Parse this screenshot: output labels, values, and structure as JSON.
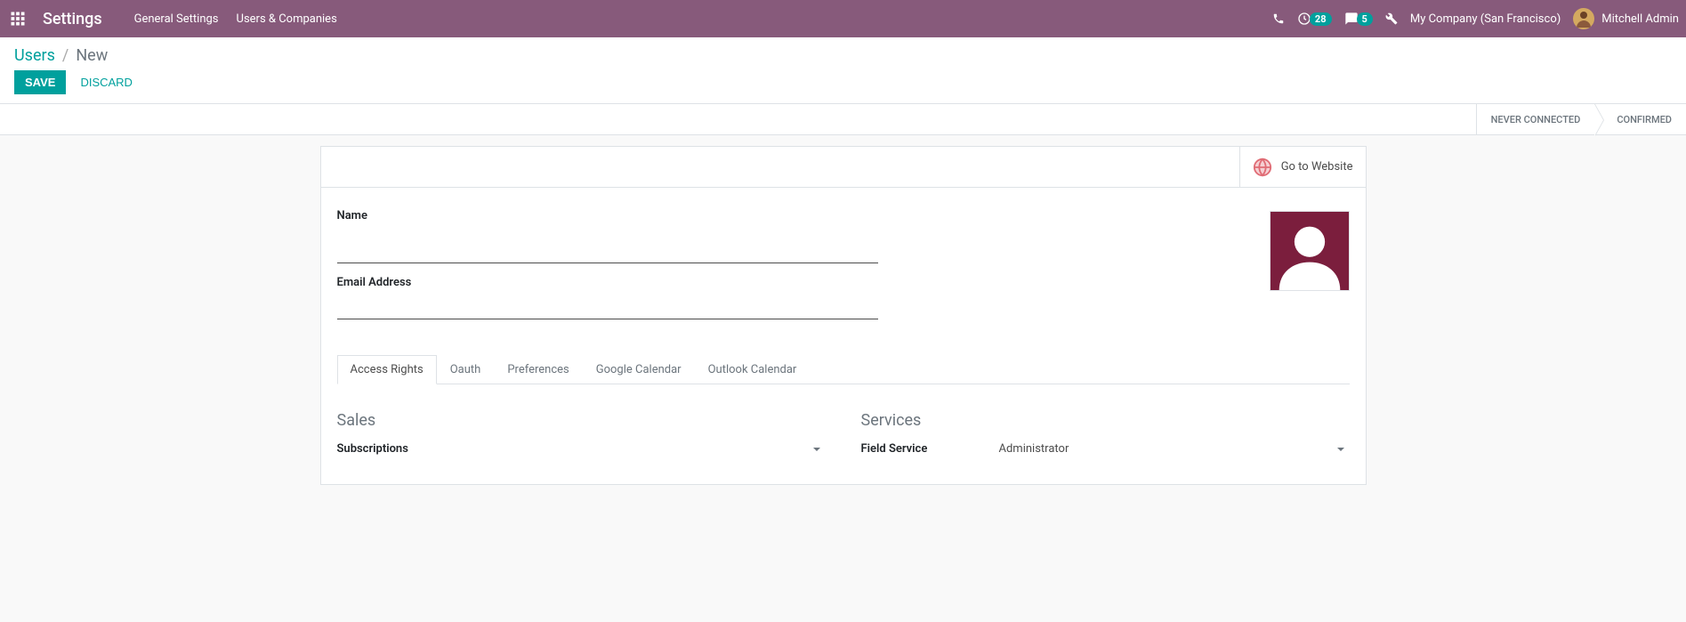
{
  "nav": {
    "app_title": "Settings",
    "links": [
      "General Settings",
      "Users & Companies"
    ],
    "badge1": "28",
    "badge2": "5",
    "company": "My Company (San Francisco)",
    "user": "Mitchell Admin"
  },
  "breadcrumb": {
    "parent": "Users",
    "separator": "/",
    "current": "New"
  },
  "actions": {
    "save": "SAVE",
    "discard": "DISCARD"
  },
  "status": {
    "never_connected": "NEVER CONNECTED",
    "confirmed": "CONFIRMED"
  },
  "form": {
    "go_website": "Go to Website",
    "name_label": "Name",
    "name_value": "",
    "email_label": "Email Address",
    "email_value": ""
  },
  "tabs": [
    "Access Rights",
    "Oauth",
    "Preferences",
    "Google Calendar",
    "Outlook Calendar"
  ],
  "sections": {
    "sales": {
      "title": "Sales",
      "field_label": "Subscriptions",
      "field_value": ""
    },
    "services": {
      "title": "Services",
      "field_label": "Field Service",
      "field_value": "Administrator"
    }
  }
}
